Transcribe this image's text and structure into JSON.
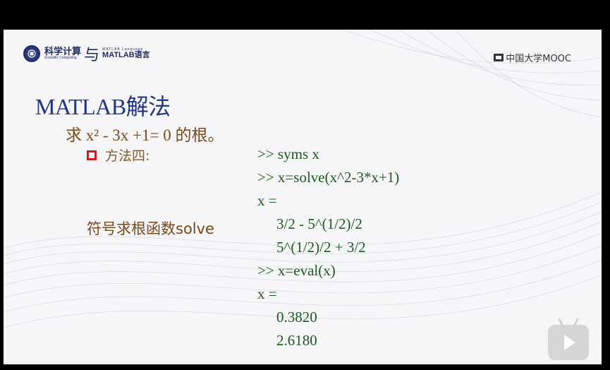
{
  "header": {
    "logo_cn": "科学计算",
    "logo_en": "Scientific Computing",
    "logo_yu": "与",
    "logo_ml_top": "MATLAB Language",
    "logo_ml": "MATLAB语言",
    "mooc": "中国大学MOOC"
  },
  "slide": {
    "title": "MATLAB解法",
    "question": "求 x² - 3x +1= 0 的根。",
    "method_label": "方法四:",
    "side_note": "符号求根函数solve",
    "code": [
      ">> syms x",
      ">> x=solve(x^2-3*x+1)",
      "x =",
      "3/2 - 5^(1/2)/2",
      "5^(1/2)/2 + 3/2",
      ">> x=eval(x)",
      "x =",
      "0.3820",
      "2.6180"
    ]
  },
  "colors": {
    "title": "#1f3585",
    "question": "#7a4a1a",
    "code": "#1d5a1d",
    "bullet": "#d11a1a"
  },
  "icons": {
    "logo": "university-seal-icon",
    "mooc": "mooc-logo-icon",
    "play": "play-icon"
  }
}
